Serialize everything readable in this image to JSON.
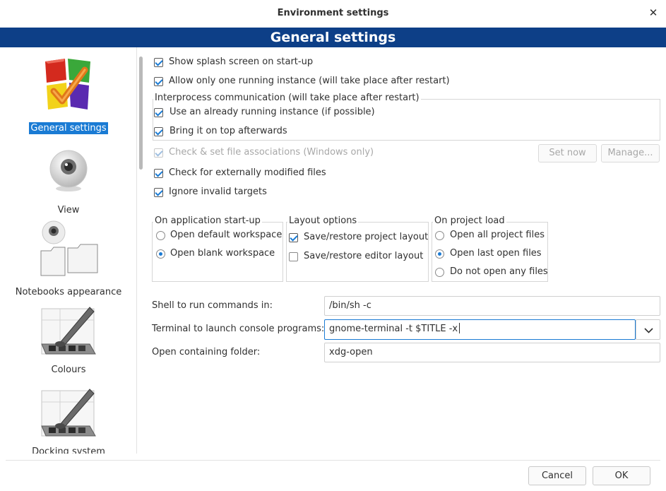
{
  "window": {
    "title": "Environment settings",
    "close_glyph": "✕"
  },
  "banner": {
    "title": "General settings"
  },
  "sidebar": {
    "items": [
      {
        "label": "General settings",
        "icon": "general-settings-icon"
      },
      {
        "label": "View",
        "icon": "eye-icon"
      },
      {
        "label": "Notebooks appearance",
        "icon": "notebooks-icon"
      },
      {
        "label": "Colours",
        "icon": "colours-palette-icon"
      },
      {
        "label": "Docking system",
        "icon": "docking-palette-icon"
      }
    ]
  },
  "general": {
    "show_splash": {
      "label": "Show splash screen on start-up",
      "checked": true
    },
    "one_instance": {
      "label": "Allow only one running instance (will take place after restart)",
      "checked": true
    },
    "ipc": {
      "title": "Interprocess communication (will take place after restart)",
      "use_running": {
        "label": "Use an already running instance (if possible)",
        "checked": true
      },
      "bring_top": {
        "label": "Bring it on top afterwards",
        "checked": true
      }
    },
    "file_assoc": {
      "label": "Check & set file associations (Windows only)",
      "checked": true,
      "enabled": false
    },
    "set_now": "Set now",
    "manage": "Manage...",
    "check_modified": {
      "label": "Check for externally modified files",
      "checked": true
    },
    "ignore_invalid": {
      "label": "Ignore invalid targets",
      "checked": true
    }
  },
  "startup": {
    "title": "On application start-up",
    "options": [
      "Open default workspace",
      "Open blank workspace"
    ],
    "selected": 1
  },
  "layout": {
    "title": "Layout options",
    "save_project": {
      "label": "Save/restore project layout",
      "checked": true
    },
    "save_editor": {
      "label": "Save/restore editor layout",
      "checked": false
    }
  },
  "project_load": {
    "title": "On project load",
    "options": [
      "Open all project files",
      "Open last open files",
      "Do not open any files"
    ],
    "selected": 1
  },
  "commands": {
    "shell_label": "Shell to run commands in:",
    "shell_value": "/bin/sh -c",
    "terminal_label": "Terminal to launch console programs:",
    "terminal_value": "gnome-terminal -t $TITLE -x",
    "folder_label": "Open containing folder:",
    "folder_value": "xdg-open"
  },
  "footer": {
    "cancel": "Cancel",
    "ok": "OK"
  }
}
